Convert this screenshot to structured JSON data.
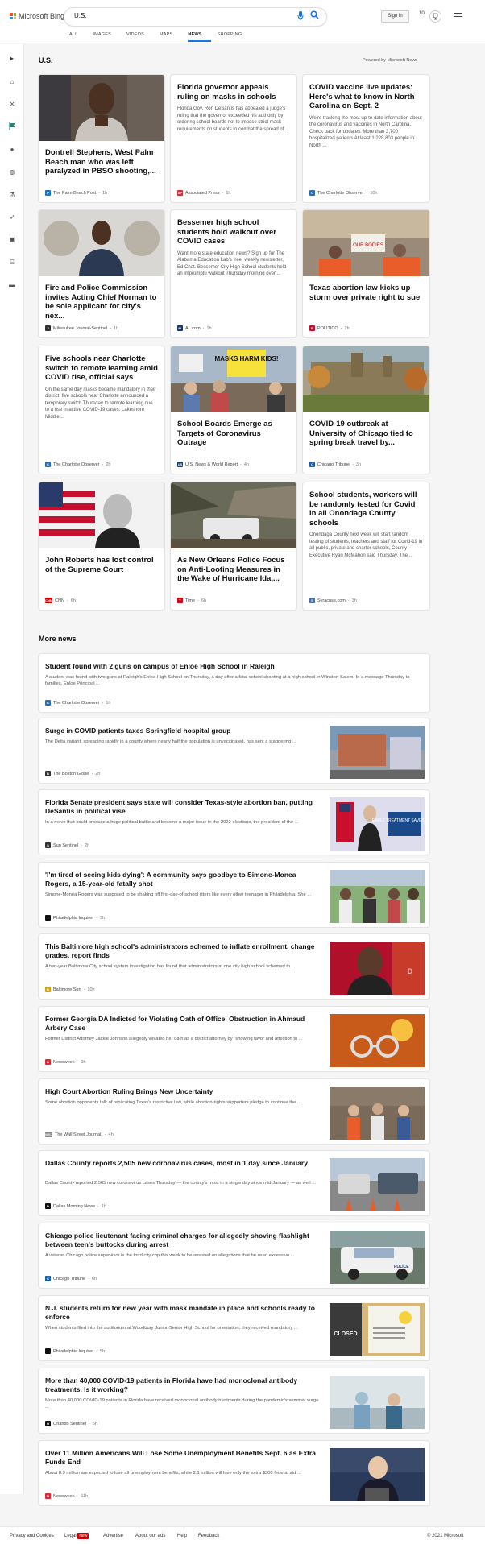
{
  "header": {
    "brand": "Microsoft Bing",
    "search_value": "U.S.",
    "tabs": [
      {
        "label": "ALL"
      },
      {
        "label": "IMAGES"
      },
      {
        "label": "VIDEOS"
      },
      {
        "label": "MAPS"
      },
      {
        "label": "NEWS"
      },
      {
        "label": "SHOPPING"
      }
    ],
    "signin_label": "Sign in",
    "rewards_count": "10",
    "icons": {
      "search": "search-icon",
      "mic": "microphone-icon",
      "trophy": "trophy-icon",
      "menu": "hamburger-menu-icon"
    }
  },
  "sidebar": {
    "icons": [
      "expand-icon",
      "home-icon",
      "sports-icon",
      "flag-icon",
      "location-icon",
      "globe-icon",
      "science-icon",
      "rocket-icon",
      "movie-icon",
      "bank-icon",
      "money-icon"
    ]
  },
  "top_section": {
    "title": "U.S.",
    "powered_by": "Powered by Microsoft News"
  },
  "cards": [
    {
      "title": "Dontrell Stephens, West Palm Beach man who was left paralyzed in PBSO shooting,...",
      "desc": "",
      "source": "The Palm Beach Post",
      "time": "1h",
      "fav_color": "#1a73c8",
      "fav_letter": "P"
    },
    {
      "title": "Florida governor appeals ruling on masks in schools",
      "desc": "Florida Gov. Ron DeSantis has appealed a judge's ruling that the governor exceeded his authority by ordering school boards not to impose strict mask requirements on students to combat the spread of ...",
      "source": "Associated Press",
      "time": "1h",
      "fav_color": "#e8262e",
      "fav_letter": "AP"
    },
    {
      "title": "COVID vaccine live updates: Here's what to know in North Carolina on Sept. 2",
      "desc": "We're tracking the most up-to-date information about the coronavirus and vaccines in North Carolina. Check back for updates. More than 3,700 hospitalized patients At least 1,228,803 people in North ...",
      "source": "The Charlotte Observer",
      "time": "10h",
      "fav_color": "#2a6fb0",
      "fav_letter": "C"
    },
    {
      "title": "Fire and Police Commission invites Acting Chief Norman to be sole applicant for city's nex...",
      "desc": "",
      "source": "Milwaukee Journal-Sentinel",
      "time": "1h",
      "fav_color": "#333",
      "fav_letter": "J"
    },
    {
      "title": "Bessemer high school students hold walkout over COVID cases",
      "desc": "Want more state education news? Sign up for The Alabama Education Lab's free, weekly newsletter, Ed Chat. Bessemer City High School students held an impromptu walkout Thursday morning over ...",
      "source": "AL.com",
      "time": "1h",
      "fav_color": "#1b3a6b",
      "fav_letter": "AL"
    },
    {
      "title": "Texas abortion law kicks up storm over private right to sue",
      "desc": "",
      "source": "POLITICO",
      "time": "2h",
      "fav_color": "#c8102e",
      "fav_letter": "P"
    },
    {
      "title": "Five schools near Charlotte switch to remote learning amid COVID rise, official says",
      "desc": "On the same day masks became mandatory in their district, five schools near Charlotte announced a temporary switch Thursday to remote learning due to a rise in active COVID-19 cases. Lakeshore Middle ...",
      "source": "The Charlotte Observer",
      "time": "2h",
      "fav_color": "#2a6fb0",
      "fav_letter": "C"
    },
    {
      "title": "School Boards Emerge as Targets of Coronavirus Outrage",
      "desc": "",
      "source": "U.S. News & World Report",
      "time": "4h",
      "fav_color": "#1b3a6b",
      "fav_letter": "US"
    },
    {
      "title": "COVID-19 outbreak at University of Chicago tied to spring break travel by...",
      "desc": "",
      "source": "Chicago Tribune",
      "time": "3h",
      "fav_color": "#1a5fa8",
      "fav_letter": "C"
    },
    {
      "title": "John Roberts has lost control of the Supreme Court",
      "desc": "",
      "source": "CNN",
      "time": "6h",
      "fav_color": "#cc0000",
      "fav_letter": "CNN"
    },
    {
      "title": "As New Orleans Police Focus on Anti-Looting Measures in the Wake of Hurricane Ida,...",
      "desc": "",
      "source": "Time",
      "time": "6h",
      "fav_color": "#e0001a",
      "fav_letter": "T"
    },
    {
      "title": "School students, workers will be randomly tested for Covid in all Onondaga County schools",
      "desc": "Onondaga County next week will start random testing of students, teachers and staff for Covid-19 in all public, private and charter schools, County Executive Ryan McMahon said Thursday. The ...",
      "source": "Syracuse.com",
      "time": "3h",
      "fav_color": "#4a6fa5",
      "fav_letter": "S"
    }
  ],
  "more_news": {
    "title": "More news",
    "items": [
      {
        "title": "Student found with 2 guns on campus of Enloe High School in Raleigh",
        "desc": "A student was found with two guns at Raleigh's Enloe High School on Thursday, a day after a fatal school shooting at a high school in Winston-Salem. In a message Thursday to families, Enloe Principal ...",
        "source": "The Charlotte Observer",
        "time": "1h",
        "fav_color": "#2a6fb0",
        "fav_letter": "C"
      },
      {
        "title": "Surge in COVID patients taxes Springfield hospital group",
        "desc": "The Delta variant, spreading rapidly in a county where nearly half the population is unvaccinated, has sent a staggering ...",
        "source": "The Boston Globe",
        "time": "2h",
        "fav_color": "#333",
        "fav_letter": "B"
      },
      {
        "title": "Florida Senate president says state will consider Texas-style abortion ban, putting DeSantis in political vise",
        "desc": "In a move that could produce a huge political battle and become a major issue in the 2022 elections, the president of the ...",
        "source": "Sun Sentinel",
        "time": "2h",
        "fav_color": "#333",
        "fav_letter": "S"
      },
      {
        "title": "'I'm tired of seeing kids dying': A community says goodbye to Simone-Monea Rogers, a 15-year-old fatally shot",
        "desc": "Simone-Monea Rogers was supposed to be shaking off first-day-of-school jitters like every other teenager in Philadelphia. She ...",
        "source": "Philadelphia Inquirer",
        "time": "3h",
        "fav_color": "#111",
        "fav_letter": "I"
      },
      {
        "title": "This Baltimore high school's administrators schemed to inflate enrollment, change grades, report finds",
        "desc": "A two-year Baltimore City school system investigation has found that administrators at one city high school schemed to ...",
        "source": "Baltimore Sun",
        "time": "10h",
        "fav_color": "#d4a017",
        "fav_letter": "B"
      },
      {
        "title": "Former Georgia DA Indicted for Violating Oath of Office, Obstruction in Ahmaud Arbery Case",
        "desc": "Former District Attorney Jackie Johnson allegedly violated her oath as a district attorney by \"showing favor and affection to ...",
        "source": "Newsweek",
        "time": "2h",
        "fav_color": "#e8262e",
        "fav_letter": "N"
      },
      {
        "title": "High Court Abortion Ruling Brings New Uncertainty",
        "desc": "Some abortion opponents talk of replicating Texas's restrictive law, while abortion-rights supporters pledge to continue the ...",
        "source": "The Wall Street Journal.",
        "time": "4h",
        "fav_color": "#888",
        "fav_letter": "WSJ"
      },
      {
        "title": "Dallas County reports 2,505 new coronavirus cases, most in 1 day since January",
        "desc": "Dallas County reported 2,505 new coronavirus cases Thursday — the county's most in a single day since mid-January — as well ...",
        "source": "Dallas Morning News",
        "time": "1h",
        "fav_color": "#111",
        "fav_letter": "D"
      },
      {
        "title": "Chicago police lieutenant facing criminal charges for allegedly shoving flashlight between teen's buttocks during arrest",
        "desc": "A veteran Chicago police supervisor is the third city cop this week to be arrested on allegations that he used excessive ...",
        "source": "Chicago Tribune",
        "time": "6h",
        "fav_color": "#1a5fa8",
        "fav_letter": "C"
      },
      {
        "title": "N.J. students return for new year with mask mandate in place and schools ready to enforce",
        "desc": "When students filed into the auditorium at Woodbury Junior-Senior High School for orientation, they received mandatory ...",
        "source": "Philadelphia Inquirer",
        "time": "5h",
        "fav_color": "#111",
        "fav_letter": "I"
      },
      {
        "title": "More than 40,000 COVID-19 patients in Florida have had monoclonal antibody treatments. Is it working?",
        "desc": "More than 40,000 COVID-19 patients in Florida have received monoclonal antibody treatments during the pandemic's summer surge ...",
        "source": "Orlando Sentinel",
        "time": "5h",
        "fav_color": "#111",
        "fav_letter": "O"
      },
      {
        "title": "Over 11 Million Americans Will Lose Some Unemployment Benefits Sept. 6 as Extra Funds End",
        "desc": "About 8.9 million are expected to lose all unemployment benefits, while 2.1 million will lose only the extra $300 federal aid ...",
        "source": "Newsweek",
        "time": "11h",
        "fav_color": "#e8262e",
        "fav_letter": "N"
      }
    ]
  },
  "footer": {
    "privacy": "Privacy and Cookies",
    "legal": "Legal",
    "new_badge": "New",
    "advertise": "Advertise",
    "about_ads": "About our ads",
    "help": "Help",
    "feedback": "Feedback",
    "copyright": "© 2021 Microsoft"
  },
  "image_text": {
    "mask_sign": "MASKS HARM KIDS!",
    "protest_sign": "OUR BODIES",
    "early_treatment": "EARLY TREATMENT SAVES LIVES",
    "closed_sign": "CLOSED"
  }
}
